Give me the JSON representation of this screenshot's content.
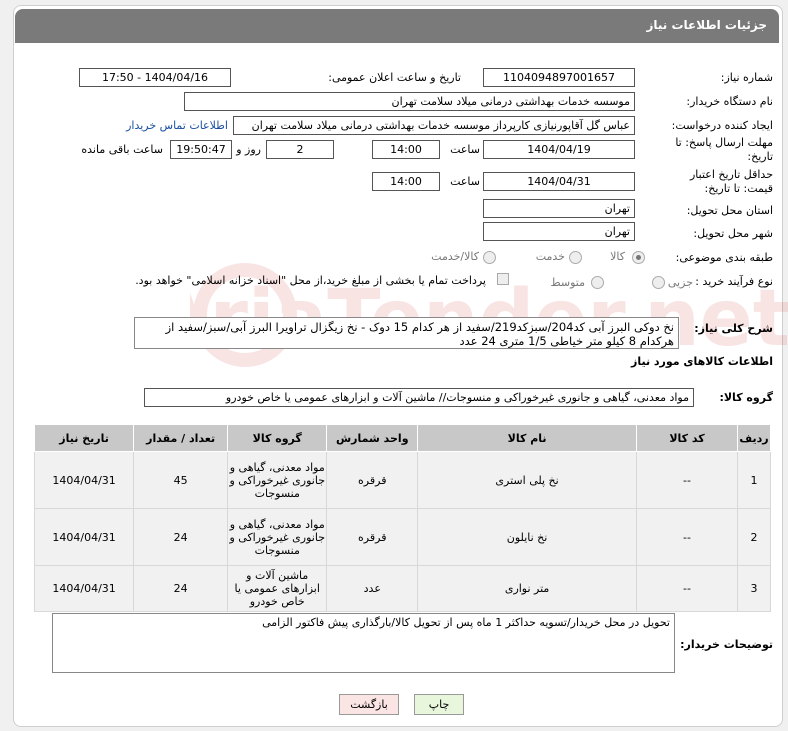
{
  "header": {
    "title": "جزئیات اطلاعات نیاز"
  },
  "form": {
    "need_number_label": "شماره نیاز:",
    "need_number": "1104094897001657",
    "announce_label": "تاریخ و ساعت اعلان عمومی:",
    "announce_value": "1404/04/16 - 17:50",
    "buyer_org_label": "نام دستگاه خریدار:",
    "buyer_org": "موسسه خدمات بهداشتی درمانی میلاد سلامت تهران",
    "creator_label": "ایجاد کننده درخواست:",
    "creator": "عباس گل آقاپورنیازی کارپرداز موسسه خدمات بهداشتی درمانی میلاد سلامت تهران",
    "contact_link": "اطلاعات تماس خریدار",
    "send_deadline_label": "مهلت ارسال پاسخ: تا تاریخ:",
    "send_deadline_date": "1404/04/19",
    "time_label": "ساعت",
    "send_deadline_time": "14:00",
    "days_value": "2",
    "days_label": "روز و",
    "remaining_time": "19:50:47",
    "remaining_label": "ساعت باقی مانده",
    "price_validity_label": "حداقل تاریخ اعتبار قیمت: تا تاریخ:",
    "price_validity_date": "1404/04/31",
    "price_validity_time": "14:00",
    "province_label": "استان محل تحویل:",
    "province": "تهران",
    "city_label": "شهر محل تحویل:",
    "city": "تهران",
    "category_label": "طبقه بندی موضوعی:",
    "category_options": [
      "کالا",
      "خدمت",
      "کالا/خدمت"
    ],
    "purchase_type_label": "نوع فرآیند خرید :",
    "purchase_options": [
      "جزیی",
      "متوسط"
    ],
    "payment_note": "پرداخت تمام یا بخشی از مبلغ خرید،از محل \"اسناد خزانه اسلامی\" خواهد بود.",
    "description_label": "شرح کلی نیاز:",
    "description": "نخ دوکی البرز آبی کد204/سبزکد219/سفید از هر کدام 15 دوک - نخ زیگزال تراویرا  البرز آبی/سبز/سفید از هرکدام 8 کیلو متر خیاطی 1/5 متری 24 عدد",
    "goods_info_title": "اطلاعات کالاهای مورد نیاز",
    "goods_group_label": "گروه کالا:",
    "goods_group": "مواد معدنی، گیاهی و جانوری غیرخوراکی و منسوجات//  ماشین آلات و ابزارهای عمومی یا خاص خودرو"
  },
  "table": {
    "headers": [
      "ردیف",
      "کد کالا",
      "نام کالا",
      "واحد شمارش",
      "گروه کالا",
      "تعداد / مقدار",
      "تاریخ نیاز"
    ],
    "rows": [
      {
        "row": "1",
        "code": "--",
        "name": "نخ پلی استری",
        "unit": "قرقره",
        "group": "مواد معدنی، گیاهی و جانوری غیرخوراکی و منسوجات",
        "qty": "45",
        "date": "1404/04/31"
      },
      {
        "row": "2",
        "code": "--",
        "name": "نخ نایلون",
        "unit": "قرقره",
        "group": "مواد معدنی، گیاهی و جانوری غیرخوراکی و منسوجات",
        "qty": "24",
        "date": "1404/04/31"
      },
      {
        "row": "3",
        "code": "--",
        "name": "متر نواری",
        "unit": "عدد",
        "group": "ماشین آلات و ابزارهای عمومی یا خاص خودرو",
        "qty": "24",
        "date": "1404/04/31"
      }
    ]
  },
  "buyer_notes_label": "توضیحات خریدار:",
  "buyer_notes": "تحویل در محل خریدار/تسویه حداکثر 1 ماه پس از تحویل کالا/بارگذاری پیش فاکتور الزامی",
  "buttons": {
    "print": "چاپ",
    "back": "بازگشت"
  },
  "watermark": "AriaTender.net"
}
